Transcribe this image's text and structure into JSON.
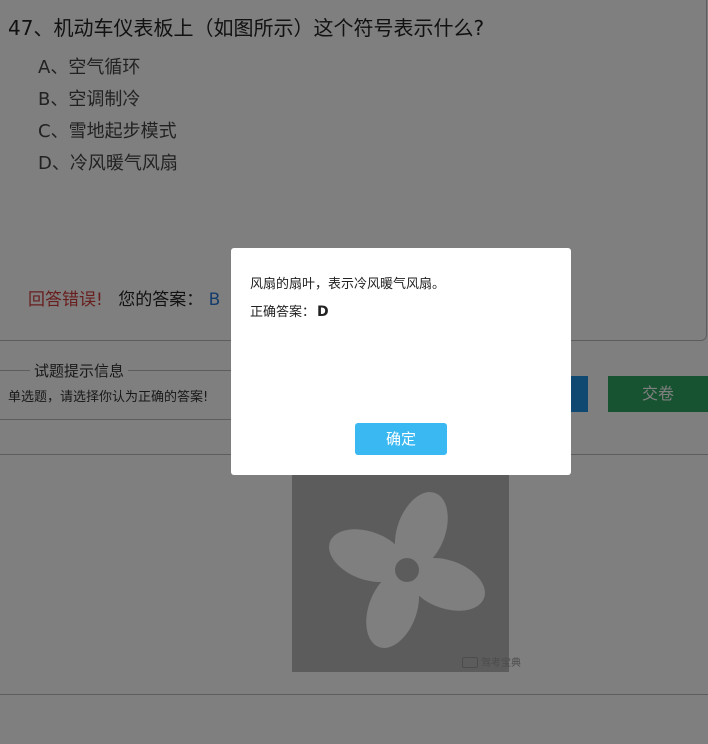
{
  "question": {
    "title": "47、机动车仪表板上（如图所示）这个符号表示什么?",
    "options": [
      {
        "label": "A、空气循环"
      },
      {
        "label": "B、空调制冷"
      },
      {
        "label": "C、雪地起步模式"
      },
      {
        "label": "D、冷风暖气风扇"
      }
    ]
  },
  "result": {
    "status": "回答错误!",
    "your_answer_label": "您的答案：",
    "your_answer": "B"
  },
  "hint": {
    "title": "试题提示信息",
    "text": "单选题，请选择你认为正确的答案!"
  },
  "buttons": {
    "submit_label": "交卷"
  },
  "image": {
    "watermark": "驾考宝典"
  },
  "modal": {
    "explanation": "风扇的扇叶，表示冷风暖气风扇。",
    "correct_answer_label": "正确答案：",
    "correct_answer": "D",
    "confirm_label": "确定"
  },
  "colors": {
    "wrong": "#d23c3c",
    "answer": "#2a7bd8",
    "submit_button": "#2ea663",
    "blue_button": "#1e90e0",
    "confirm_button": "#3ab8f2",
    "overlay": "rgba(0,0,0,0.5)"
  }
}
